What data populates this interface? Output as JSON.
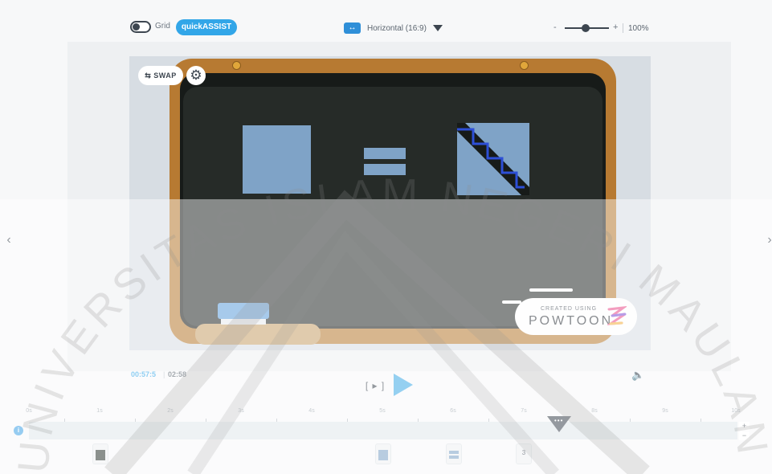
{
  "toolbar": {
    "grid_label": "Grid",
    "quick_assist_label": "quickASSIST",
    "orientation_label": "Horizontal (16:9)",
    "zoom_minus": "-",
    "zoom_plus": "+",
    "zoom_value": "100%",
    "zoom_level_fraction": 0.45
  },
  "canvas": {
    "swap_label": "SWAP",
    "watermark_small": "CREATED USING",
    "watermark_big": "POWTOON"
  },
  "playback": {
    "current_time": "00:57:5",
    "separator": "|",
    "total_time": "02:58",
    "step_label": "[ ▸ ]"
  },
  "timeline": {
    "ticks": [
      "0s",
      "1s",
      "2s",
      "3s",
      "4s",
      "5s",
      "6s",
      "7s",
      "8s",
      "9s",
      "10s"
    ],
    "playhead_dots": "•••",
    "zoom_in": "+",
    "zoom_out": "−",
    "info_icon": "i",
    "thumbnail_number": "3"
  },
  "watermark_text": "UNIVERSITAS ISLAM NEGERI MAULANA MALIK IBRAHIM",
  "colors": {
    "accent": "#32a6e8",
    "board_frame": "#b77a32",
    "slate": "#262b28",
    "shape": "#7fa3c7",
    "stair": "#2d4fd6"
  },
  "icons": {
    "grid_toggle": "toggle-icon",
    "orientation": "horizontal-arrows-icon",
    "swap": "swap-arrows-icon",
    "settings": "gear-icon",
    "play": "play-icon",
    "volume": "volume-icon",
    "prev": "chevron-left-icon",
    "next": "chevron-right-icon"
  }
}
